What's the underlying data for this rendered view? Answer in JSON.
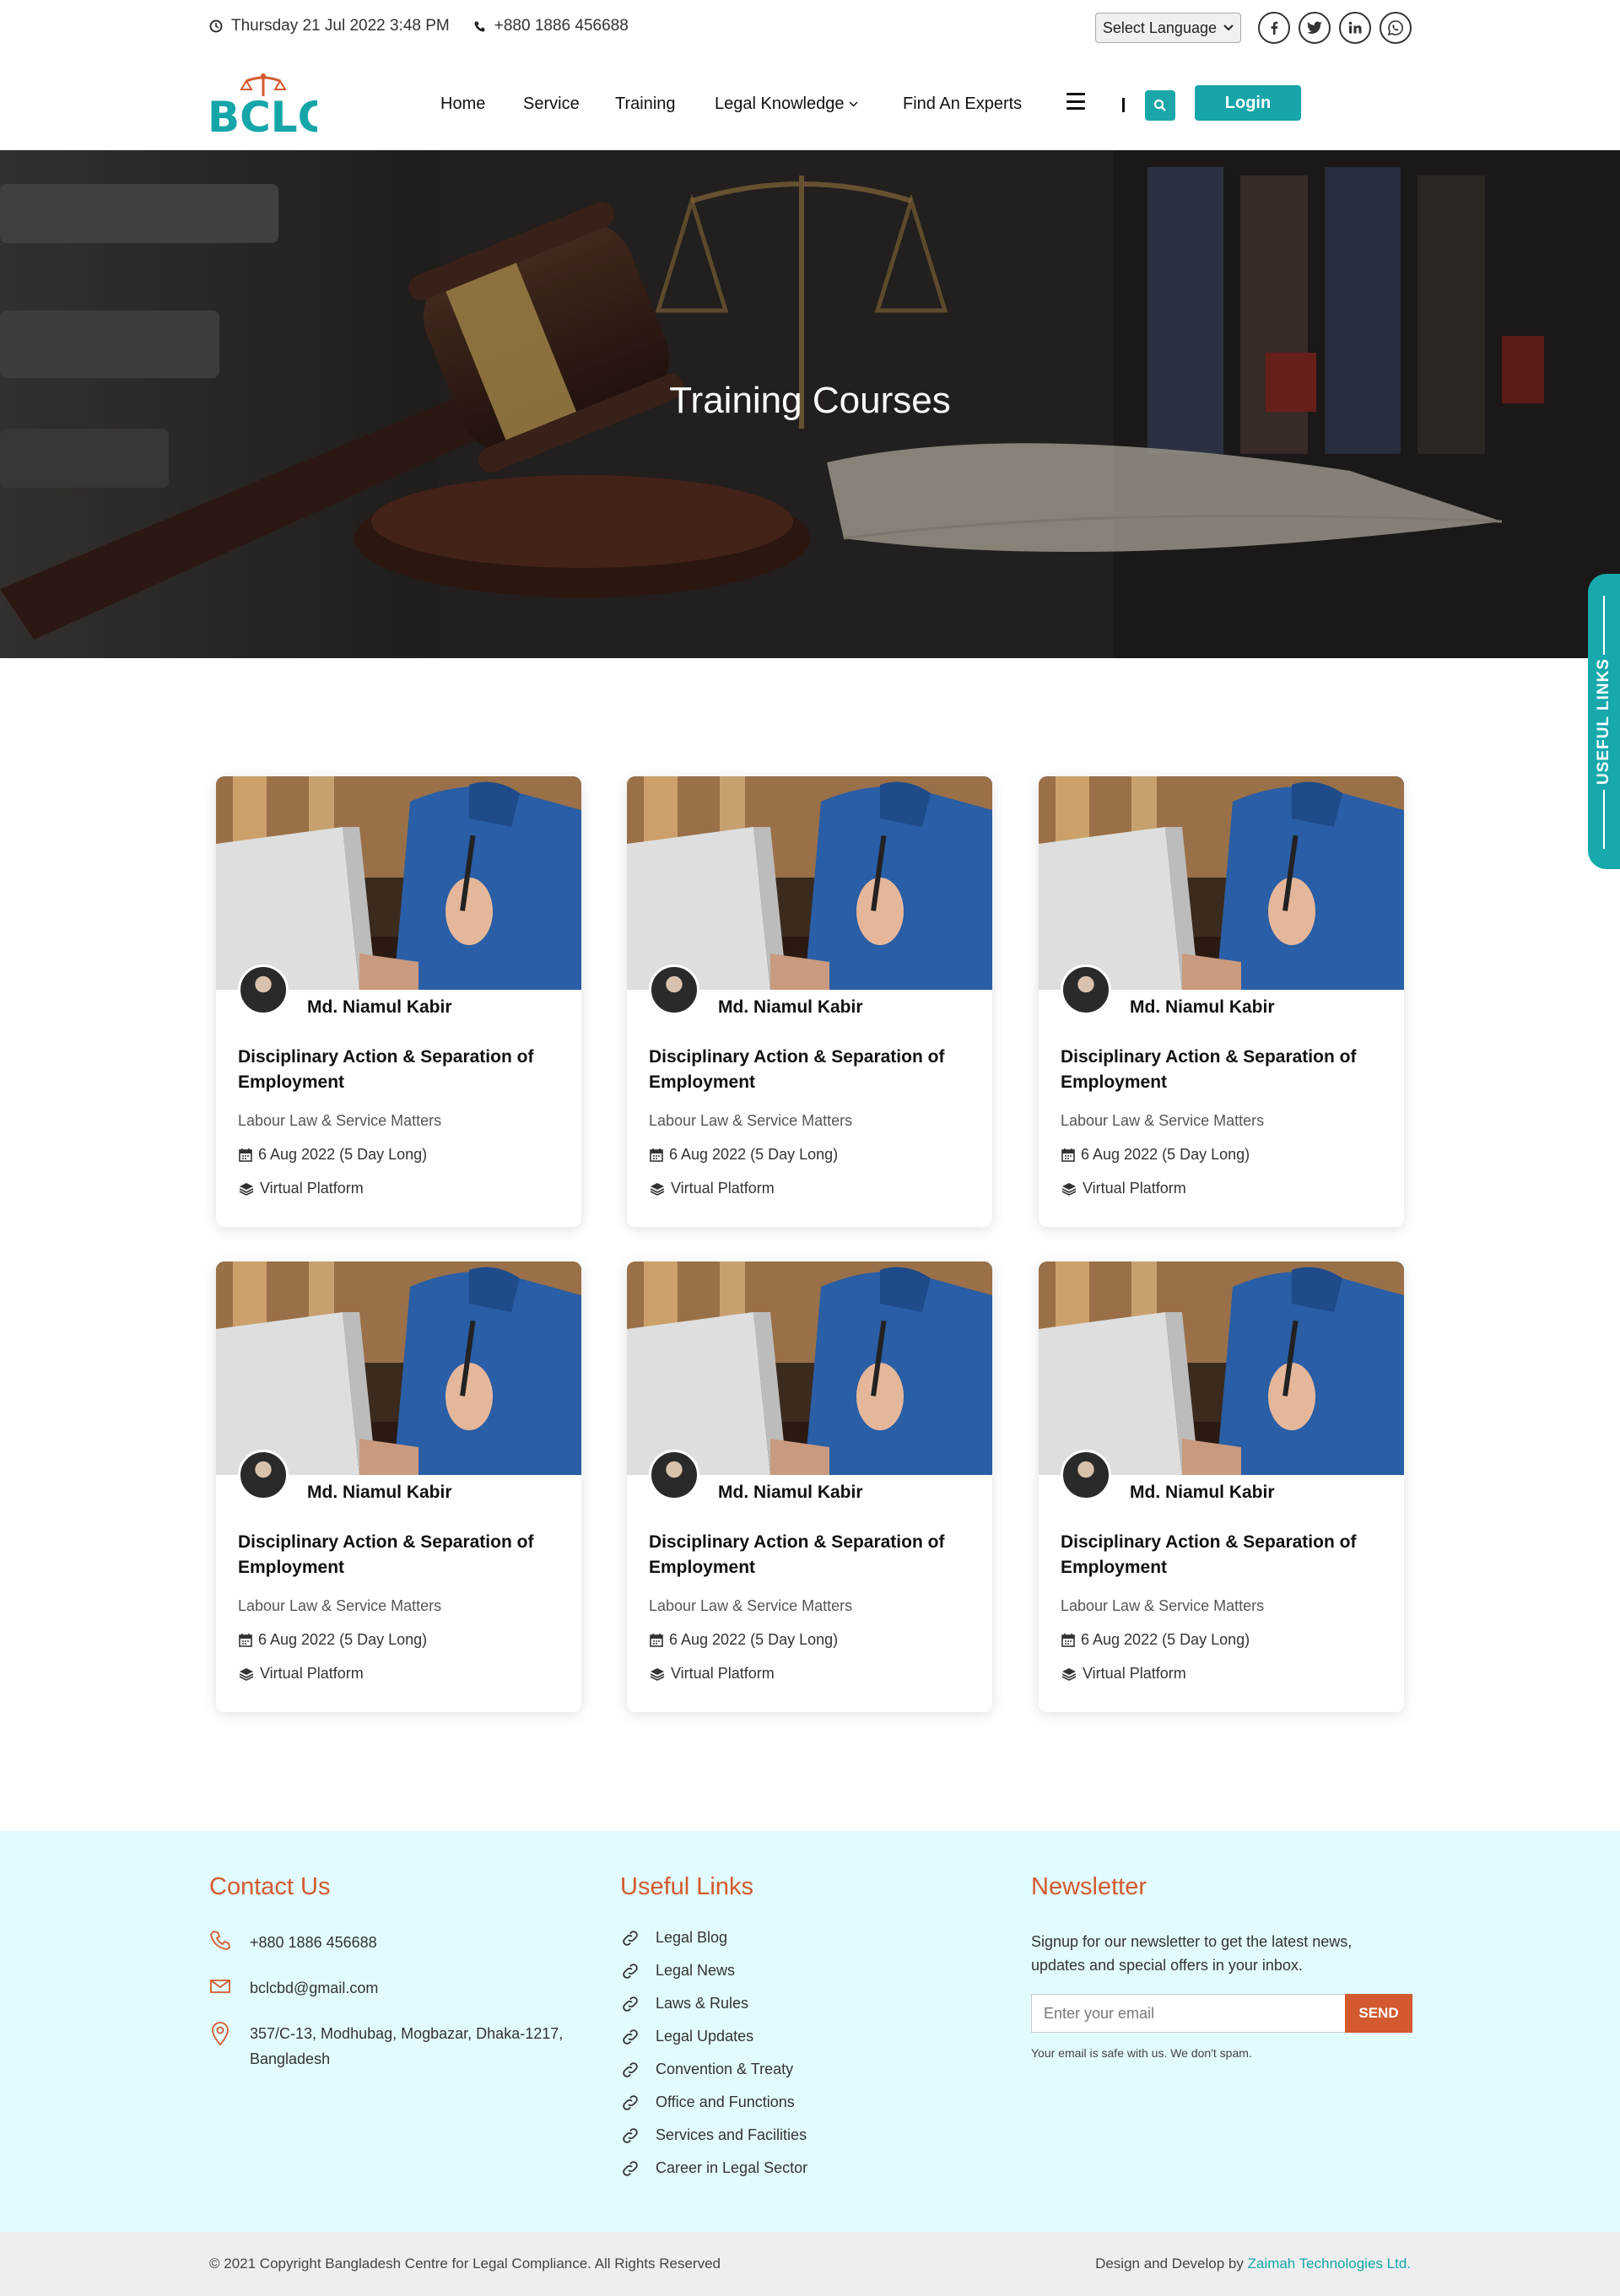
{
  "topbar": {
    "datetime": "Thursday 21 Jul 2022 3:48 PM",
    "phone": "+880 1886 456688",
    "language_select": "Select Language",
    "social_icons": [
      "facebook-icon",
      "twitter-icon",
      "linkedin-icon",
      "whatsapp-icon"
    ]
  },
  "nav": {
    "logo_text": "BCLC",
    "items": [
      {
        "label": "Home"
      },
      {
        "label": "Service"
      },
      {
        "label": "Training"
      },
      {
        "label": "Legal Knowledge",
        "dropdown": true
      },
      {
        "label": "Find An Experts"
      }
    ],
    "separator": "|",
    "login_label": "Login"
  },
  "hero": {
    "title": "Training Courses"
  },
  "useful_links_tab": "USEFUL LINKS",
  "courses": [
    {
      "instructor": "Md. Niamul Kabir",
      "title": "Disciplinary Action & Separation of Employment",
      "category": "Labour Law & Service Matters",
      "date": "6 Aug 2022 (5 Day Long)",
      "platform": "Virtual Platform"
    },
    {
      "instructor": "Md. Niamul Kabir",
      "title": "Disciplinary Action & Separation of Employment",
      "category": "Labour Law & Service Matters",
      "date": "6 Aug 2022 (5 Day Long)",
      "platform": "Virtual Platform"
    },
    {
      "instructor": "Md. Niamul Kabir",
      "title": "Disciplinary Action & Separation of Employment",
      "category": "Labour Law & Service Matters",
      "date": "6 Aug 2022 (5 Day Long)",
      "platform": "Virtual Platform"
    },
    {
      "instructor": "Md. Niamul Kabir",
      "title": "Disciplinary Action & Separation of Employment",
      "category": "Labour Law & Service Matters",
      "date": "6 Aug 2022 (5 Day Long)",
      "platform": "Virtual Platform"
    },
    {
      "instructor": "Md. Niamul Kabir",
      "title": "Disciplinary Action & Separation of Employment",
      "category": "Labour Law & Service Matters",
      "date": "6 Aug 2022 (5 Day Long)",
      "platform": "Virtual Platform"
    },
    {
      "instructor": "Md. Niamul Kabir",
      "title": "Disciplinary Action & Separation of Employment",
      "category": "Labour Law & Service Matters",
      "date": "6 Aug 2022 (5 Day Long)",
      "platform": "Virtual Platform"
    }
  ],
  "footer": {
    "contact": {
      "heading": "Contact Us",
      "phone": "+880 1886 456688",
      "email": "bclcbd@gmail.com",
      "address_line1": "357/C-13, Modhubag, Mogbazar, Dhaka-1217,",
      "address_line2": "Bangladesh"
    },
    "links": {
      "heading": "Useful Links",
      "items": [
        "Legal Blog",
        "Legal News",
        "Laws & Rules",
        "Legal Updates",
        "Convention & Treaty",
        "Office and Functions",
        "Services and Facilities",
        "Career in Legal Sector"
      ]
    },
    "newsletter": {
      "heading": "Newsletter",
      "text": "Signup for our newsletter to get the latest news, updates and special offers in your inbox.",
      "placeholder": "Enter your email",
      "send_label": "SEND",
      "note": "Your email is safe with us. We don't spam."
    }
  },
  "bottom": {
    "copyright": "© 2021 Copyright Bangladesh Centre for Legal Compliance. All Rights Reserved",
    "credit_prefix": "Design and Develop by",
    "credit_link": "Zaimah Technologies Ltd."
  },
  "colors": {
    "teal": "#16a5a8",
    "orange": "#d35a2e",
    "footer_bg": "#e2fbfd"
  }
}
